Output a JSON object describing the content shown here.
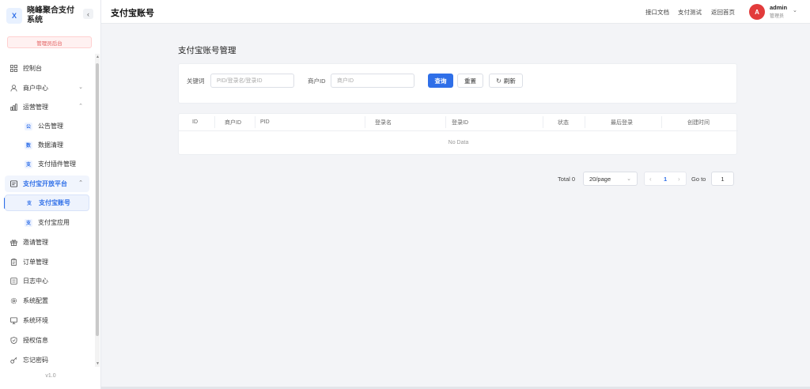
{
  "brand": {
    "logo_letter": "X",
    "name": "晓峰聚合支付系统",
    "collapse_icon": "chevron-left-icon"
  },
  "admin_badge": "管理员后台",
  "sidebar": {
    "items": [
      {
        "label": "控制台",
        "icon": "dashboard-icon"
      },
      {
        "label": "商户中心",
        "icon": "user-icon",
        "chevron": "⌄"
      },
      {
        "label": "运营管理",
        "icon": "chart-icon",
        "chevron": "⌃"
      },
      {
        "label": "公告管理",
        "sub_icon": "公"
      },
      {
        "label": "数据清理",
        "sub_icon": "数"
      },
      {
        "label": "支付插件管理",
        "sub_icon": "支"
      },
      {
        "label": "支付宝开放平台",
        "icon": "card-icon",
        "chevron": "⌃"
      },
      {
        "label": "支付宝账号",
        "sub_icon": "支"
      },
      {
        "label": "支付宝应用",
        "sub_icon": "支"
      },
      {
        "label": "邀请管理",
        "icon": "gift-icon"
      },
      {
        "label": "订单管理",
        "icon": "clipboard-icon"
      },
      {
        "label": "日志中心",
        "icon": "log-icon"
      },
      {
        "label": "系统配置",
        "icon": "gear-icon"
      },
      {
        "label": "系统环境",
        "icon": "monitor-icon"
      },
      {
        "label": "授权信息",
        "icon": "shield-icon"
      },
      {
        "label": "忘记密码",
        "icon": "key-icon"
      }
    ],
    "version": "v1.0"
  },
  "header": {
    "title": "支付宝账号",
    "links": [
      "接口文档",
      "支付测试",
      "返回首页"
    ],
    "user": {
      "avatar_letter": "A",
      "name": "admin",
      "role": "管理员",
      "caret": "⌄"
    }
  },
  "main": {
    "section_title": "支付宝账号管理",
    "filters": {
      "keyword_label": "关键词",
      "keyword_placeholder": "PID/登录名/登录ID",
      "merchant_label": "商户ID",
      "merchant_placeholder": "商户ID",
      "query_label": "查询",
      "reset_label": "重置",
      "refresh_label": "刷新"
    },
    "table": {
      "columns": [
        "ID",
        "商户ID",
        "PID",
        "登录名",
        "登录ID",
        "状态",
        "最后登录",
        "创建时间"
      ],
      "empty_text": "No Data"
    },
    "pagination": {
      "total": "Total 0",
      "page_size": "20/page",
      "current_page": "1",
      "goto_label": "Go to",
      "goto_value": "1"
    }
  }
}
